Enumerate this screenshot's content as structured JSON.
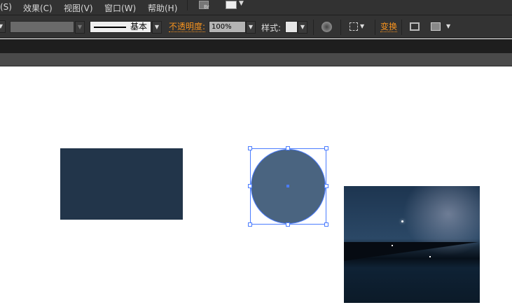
{
  "menu": [
    "(S)",
    "效果(C)",
    "视图(V)",
    "窗口(W)",
    "帮助(H)"
  ],
  "bridge_label": "Br",
  "toolbar": {
    "stroke_style": "基本",
    "opacity_label": "不透明度:",
    "opacity_value": "100%",
    "style_label": "样式:",
    "transform_label": "变换"
  },
  "colors": {
    "rect": "#22354a",
    "circle": "#4a6480",
    "selection": "#4a7cff"
  }
}
